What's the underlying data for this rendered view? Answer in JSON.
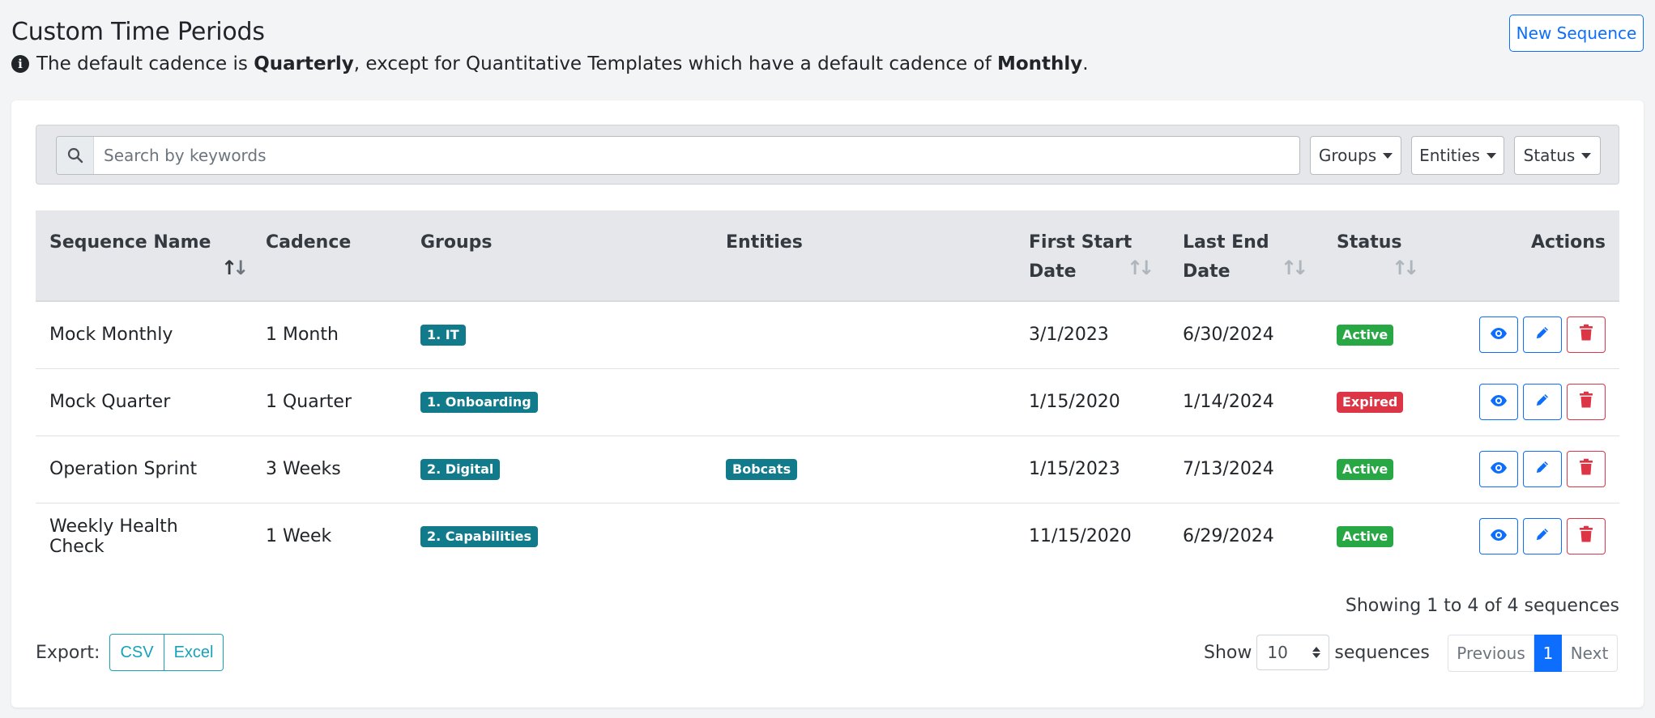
{
  "header": {
    "title": "Custom Time Periods",
    "info_prefix": "The default cadence is ",
    "info_bold1": "Quarterly",
    "info_middle": ", except for Quantitative Templates which have a default cadence of ",
    "info_bold2": "Monthly",
    "info_suffix": ".",
    "new_button": "New Sequence"
  },
  "filters": {
    "search_placeholder": "Search by keywords",
    "groups": "Groups",
    "entities": "Entities",
    "status": "Status"
  },
  "table": {
    "columns": {
      "name": "Sequence Name",
      "cadence": "Cadence",
      "groups": "Groups",
      "entities": "Entities",
      "first_start_line1": "First Start",
      "first_start_line2": "Date",
      "last_end_line1": "Last End",
      "last_end_line2": "Date",
      "status": "Status",
      "actions": "Actions"
    },
    "rows": [
      {
        "name": "Mock Monthly",
        "cadence": "1 Month",
        "group": "1. IT",
        "entity": "",
        "first_start": "3/1/2023",
        "last_end": "6/30/2024",
        "status": "Active"
      },
      {
        "name": "Mock Quarter",
        "cadence": "1 Quarter",
        "group": "1. Onboarding",
        "entity": "",
        "first_start": "1/15/2020",
        "last_end": "1/14/2024",
        "status": "Expired"
      },
      {
        "name": "Operation Sprint",
        "cadence": "3 Weeks",
        "group": "2. Digital",
        "entity": "Bobcats",
        "first_start": "1/15/2023",
        "last_end": "7/13/2024",
        "status": "Active"
      },
      {
        "name": "Weekly Health Check",
        "cadence": "1 Week",
        "group": "2. Capabilities",
        "entity": "",
        "first_start": "11/15/2020",
        "last_end": "6/29/2024",
        "status": "Active"
      }
    ]
  },
  "footer": {
    "showing": "Showing 1 to 4 of 4 sequences",
    "export_label": "Export:",
    "csv": "CSV",
    "excel": "Excel",
    "show_label": "Show",
    "page_length": "10",
    "sequences_label": "sequences",
    "previous": "Previous",
    "current_page": "1",
    "next": "Next"
  },
  "colors": {
    "primary": "#0d6efd",
    "danger": "#dc3545",
    "success": "#28a745",
    "teal": "#117a8b",
    "info": "#17a2b8"
  }
}
